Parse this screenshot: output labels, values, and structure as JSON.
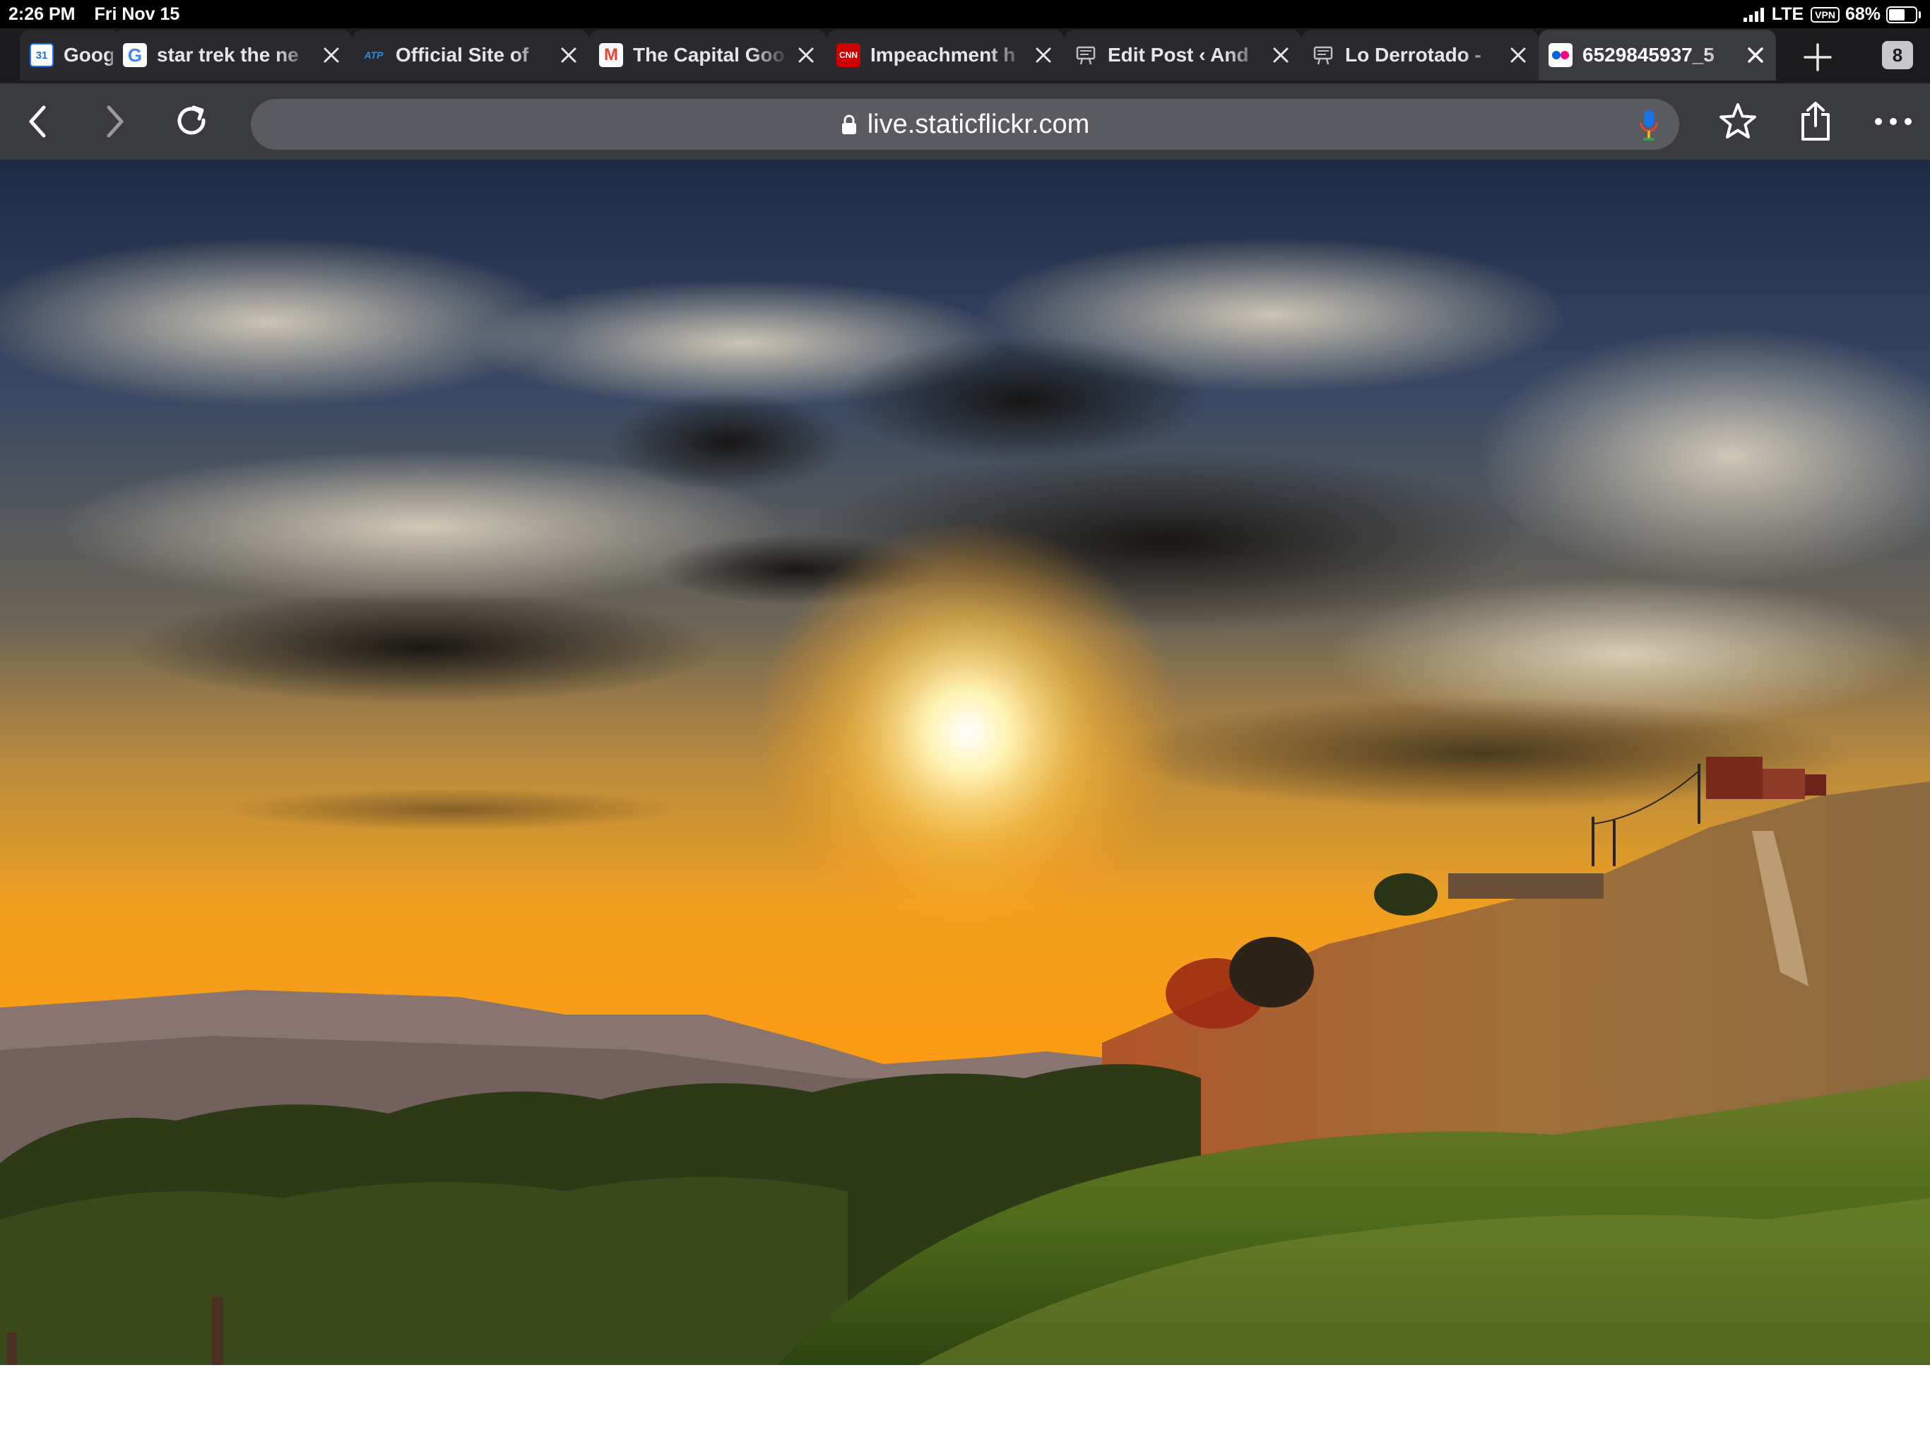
{
  "status_bar": {
    "time": "2:26 PM",
    "date": "Fri Nov 15",
    "network": "LTE",
    "vpn": "VPN",
    "battery_percent": "68%",
    "battery_level": 0.68
  },
  "tabs": [
    {
      "title": "Goog",
      "favicon": "google-calendar-icon",
      "favicon_text": "31",
      "favicon_bg": "#1a73e8",
      "active": false
    },
    {
      "title": "star trek the ne",
      "favicon": "google-icon",
      "favicon_text": "G",
      "favicon_bg": "#ffffff",
      "active": false
    },
    {
      "title": "Official Site of",
      "favicon": "atp-icon",
      "favicon_text": "ATP",
      "favicon_bg": "#2a2a2e",
      "active": false
    },
    {
      "title": "The Capital Goo",
      "favicon": "gmail-icon",
      "favicon_text": "M",
      "favicon_bg": "#ffffff",
      "active": false
    },
    {
      "title": "Impeachment h",
      "favicon": "cnn-icon",
      "favicon_text": "CNN",
      "favicon_bg": "#cc0000",
      "active": false
    },
    {
      "title": "Edit Post ‹ And",
      "favicon": "blog-icon",
      "favicon_text": "",
      "favicon_bg": "#2a2a2e",
      "active": false
    },
    {
      "title": "Lo Derrotado -",
      "favicon": "blog-icon",
      "favicon_text": "",
      "favicon_bg": "#2a2a2e",
      "active": false
    },
    {
      "title": "6529845937_5",
      "favicon": "flickr-icon",
      "favicon_text": "",
      "favicon_bg": "#ffffff",
      "active": true
    }
  ],
  "tab_count": "8",
  "address_bar": {
    "url": "live.staticflickr.com"
  },
  "colors": {
    "tab_bar": "#1c1c1e",
    "toolbar": "#3a3b3f",
    "address_field": "#5a5b60",
    "mic_blue": "#1a73e8",
    "mic_red": "#ea4335"
  }
}
